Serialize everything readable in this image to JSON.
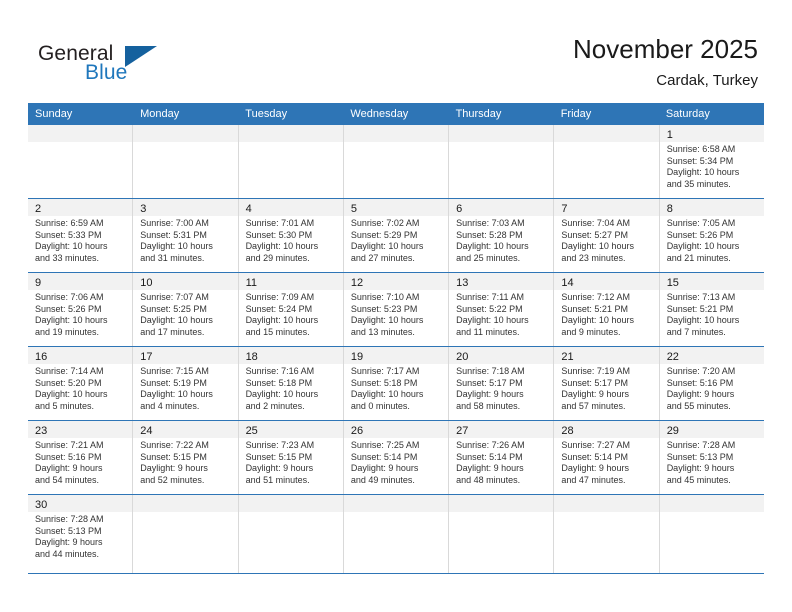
{
  "brand": {
    "name_top": "General",
    "name_bottom": "Blue",
    "triangle_icon": "triangle-icon",
    "colors": {
      "black": "#231f20",
      "blue": "#1f77bc",
      "triangle": "#15619e"
    }
  },
  "header": {
    "title": "November 2025",
    "subtitle": "Cardak, Turkey"
  },
  "theme": {
    "header_blue": "#2e75b6",
    "band_gray": "#f2f2f2",
    "grid_line": "#d9d9d9",
    "text": "#333333"
  },
  "weekdays": [
    "Sunday",
    "Monday",
    "Tuesday",
    "Wednesday",
    "Thursday",
    "Friday",
    "Saturday"
  ],
  "weeks": [
    [
      {
        "day": "",
        "lines": []
      },
      {
        "day": "",
        "lines": []
      },
      {
        "day": "",
        "lines": []
      },
      {
        "day": "",
        "lines": []
      },
      {
        "day": "",
        "lines": []
      },
      {
        "day": "",
        "lines": []
      },
      {
        "day": "1",
        "lines": [
          "Sunrise: 6:58 AM",
          "Sunset: 5:34 PM",
          "Daylight: 10 hours",
          "and 35 minutes."
        ]
      }
    ],
    [
      {
        "day": "2",
        "lines": [
          "Sunrise: 6:59 AM",
          "Sunset: 5:33 PM",
          "Daylight: 10 hours",
          "and 33 minutes."
        ]
      },
      {
        "day": "3",
        "lines": [
          "Sunrise: 7:00 AM",
          "Sunset: 5:31 PM",
          "Daylight: 10 hours",
          "and 31 minutes."
        ]
      },
      {
        "day": "4",
        "lines": [
          "Sunrise: 7:01 AM",
          "Sunset: 5:30 PM",
          "Daylight: 10 hours",
          "and 29 minutes."
        ]
      },
      {
        "day": "5",
        "lines": [
          "Sunrise: 7:02 AM",
          "Sunset: 5:29 PM",
          "Daylight: 10 hours",
          "and 27 minutes."
        ]
      },
      {
        "day": "6",
        "lines": [
          "Sunrise: 7:03 AM",
          "Sunset: 5:28 PM",
          "Daylight: 10 hours",
          "and 25 minutes."
        ]
      },
      {
        "day": "7",
        "lines": [
          "Sunrise: 7:04 AM",
          "Sunset: 5:27 PM",
          "Daylight: 10 hours",
          "and 23 minutes."
        ]
      },
      {
        "day": "8",
        "lines": [
          "Sunrise: 7:05 AM",
          "Sunset: 5:26 PM",
          "Daylight: 10 hours",
          "and 21 minutes."
        ]
      }
    ],
    [
      {
        "day": "9",
        "lines": [
          "Sunrise: 7:06 AM",
          "Sunset: 5:26 PM",
          "Daylight: 10 hours",
          "and 19 minutes."
        ]
      },
      {
        "day": "10",
        "lines": [
          "Sunrise: 7:07 AM",
          "Sunset: 5:25 PM",
          "Daylight: 10 hours",
          "and 17 minutes."
        ]
      },
      {
        "day": "11",
        "lines": [
          "Sunrise: 7:09 AM",
          "Sunset: 5:24 PM",
          "Daylight: 10 hours",
          "and 15 minutes."
        ]
      },
      {
        "day": "12",
        "lines": [
          "Sunrise: 7:10 AM",
          "Sunset: 5:23 PM",
          "Daylight: 10 hours",
          "and 13 minutes."
        ]
      },
      {
        "day": "13",
        "lines": [
          "Sunrise: 7:11 AM",
          "Sunset: 5:22 PM",
          "Daylight: 10 hours",
          "and 11 minutes."
        ]
      },
      {
        "day": "14",
        "lines": [
          "Sunrise: 7:12 AM",
          "Sunset: 5:21 PM",
          "Daylight: 10 hours",
          "and 9 minutes."
        ]
      },
      {
        "day": "15",
        "lines": [
          "Sunrise: 7:13 AM",
          "Sunset: 5:21 PM",
          "Daylight: 10 hours",
          "and 7 minutes."
        ]
      }
    ],
    [
      {
        "day": "16",
        "lines": [
          "Sunrise: 7:14 AM",
          "Sunset: 5:20 PM",
          "Daylight: 10 hours",
          "and 5 minutes."
        ]
      },
      {
        "day": "17",
        "lines": [
          "Sunrise: 7:15 AM",
          "Sunset: 5:19 PM",
          "Daylight: 10 hours",
          "and 4 minutes."
        ]
      },
      {
        "day": "18",
        "lines": [
          "Sunrise: 7:16 AM",
          "Sunset: 5:18 PM",
          "Daylight: 10 hours",
          "and 2 minutes."
        ]
      },
      {
        "day": "19",
        "lines": [
          "Sunrise: 7:17 AM",
          "Sunset: 5:18 PM",
          "Daylight: 10 hours",
          "and 0 minutes."
        ]
      },
      {
        "day": "20",
        "lines": [
          "Sunrise: 7:18 AM",
          "Sunset: 5:17 PM",
          "Daylight: 9 hours",
          "and 58 minutes."
        ]
      },
      {
        "day": "21",
        "lines": [
          "Sunrise: 7:19 AM",
          "Sunset: 5:17 PM",
          "Daylight: 9 hours",
          "and 57 minutes."
        ]
      },
      {
        "day": "22",
        "lines": [
          "Sunrise: 7:20 AM",
          "Sunset: 5:16 PM",
          "Daylight: 9 hours",
          "and 55 minutes."
        ]
      }
    ],
    [
      {
        "day": "23",
        "lines": [
          "Sunrise: 7:21 AM",
          "Sunset: 5:16 PM",
          "Daylight: 9 hours",
          "and 54 minutes."
        ]
      },
      {
        "day": "24",
        "lines": [
          "Sunrise: 7:22 AM",
          "Sunset: 5:15 PM",
          "Daylight: 9 hours",
          "and 52 minutes."
        ]
      },
      {
        "day": "25",
        "lines": [
          "Sunrise: 7:23 AM",
          "Sunset: 5:15 PM",
          "Daylight: 9 hours",
          "and 51 minutes."
        ]
      },
      {
        "day": "26",
        "lines": [
          "Sunrise: 7:25 AM",
          "Sunset: 5:14 PM",
          "Daylight: 9 hours",
          "and 49 minutes."
        ]
      },
      {
        "day": "27",
        "lines": [
          "Sunrise: 7:26 AM",
          "Sunset: 5:14 PM",
          "Daylight: 9 hours",
          "and 48 minutes."
        ]
      },
      {
        "day": "28",
        "lines": [
          "Sunrise: 7:27 AM",
          "Sunset: 5:14 PM",
          "Daylight: 9 hours",
          "and 47 minutes."
        ]
      },
      {
        "day": "29",
        "lines": [
          "Sunrise: 7:28 AM",
          "Sunset: 5:13 PM",
          "Daylight: 9 hours",
          "and 45 minutes."
        ]
      }
    ],
    [
      {
        "day": "30",
        "lines": [
          "Sunrise: 7:28 AM",
          "Sunset: 5:13 PM",
          "Daylight: 9 hours",
          "and 44 minutes."
        ]
      },
      {
        "day": "",
        "lines": []
      },
      {
        "day": "",
        "lines": []
      },
      {
        "day": "",
        "lines": []
      },
      {
        "day": "",
        "lines": []
      },
      {
        "day": "",
        "lines": []
      },
      {
        "day": "",
        "lines": []
      }
    ]
  ]
}
